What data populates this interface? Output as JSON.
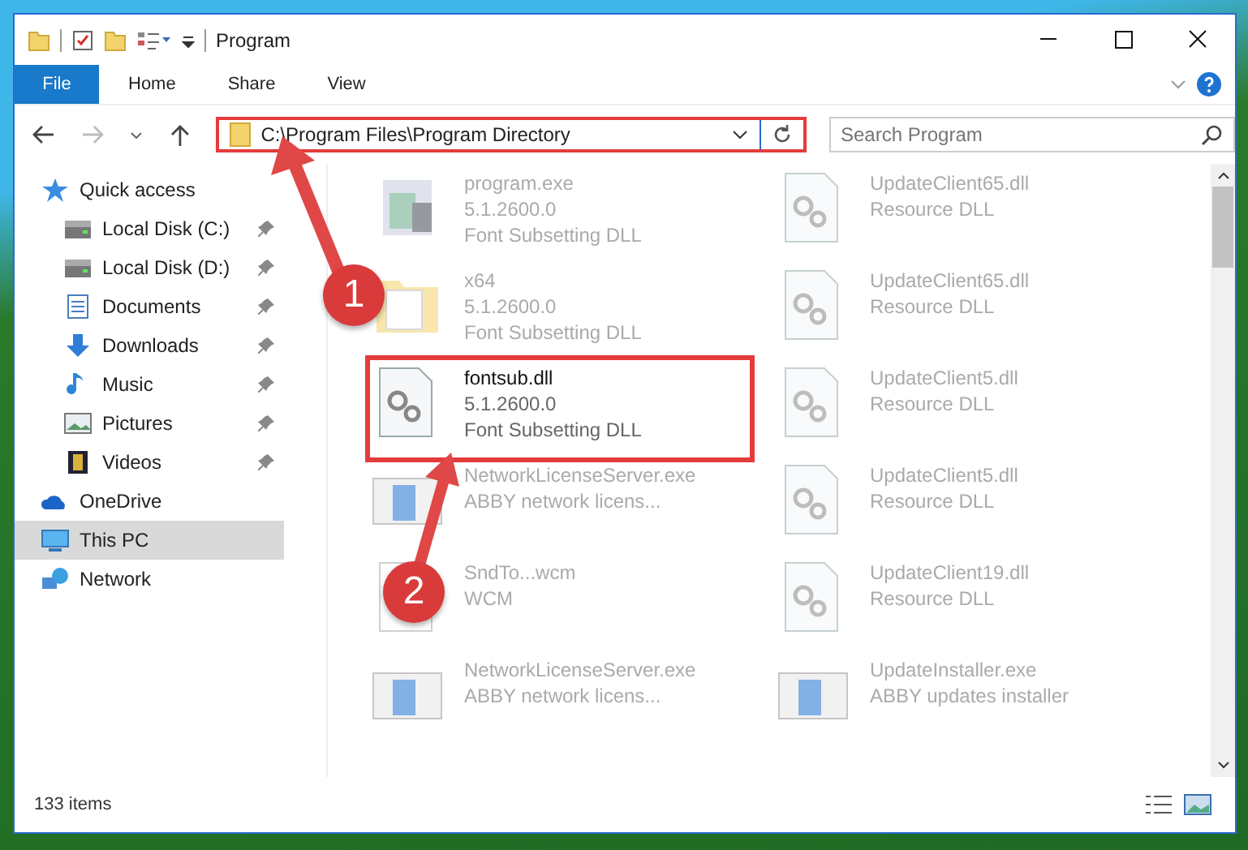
{
  "window": {
    "title": "Program"
  },
  "ribbon_tabs": [
    {
      "label": "File",
      "selected": true
    },
    {
      "label": "Home",
      "selected": false
    },
    {
      "label": "Share",
      "selected": false
    },
    {
      "label": "View",
      "selected": false
    }
  ],
  "address": {
    "path": "C:\\Program Files\\Program Directory"
  },
  "search": {
    "placeholder": "Search Program"
  },
  "sidebar": {
    "items": [
      {
        "label": "Quick access",
        "kind": "star",
        "selected": false,
        "children": [
          {
            "label": "Local Disk (C:)",
            "kind": "disk",
            "pinned": true,
            "selected": false
          },
          {
            "label": "Local Disk (D:)",
            "kind": "disk",
            "pinned": true,
            "selected": false
          },
          {
            "label": "Documents",
            "kind": "document",
            "pinned": true,
            "selected": false
          },
          {
            "label": "Downloads",
            "kind": "download",
            "pinned": true,
            "selected": false
          },
          {
            "label": "Music",
            "kind": "music",
            "pinned": true,
            "selected": false
          },
          {
            "label": "Pictures",
            "kind": "pictures",
            "pinned": true,
            "selected": false
          },
          {
            "label": "Videos",
            "kind": "videos",
            "pinned": true,
            "selected": false
          }
        ]
      },
      {
        "label": "OneDrive",
        "kind": "cloud",
        "selected": false
      },
      {
        "label": "This PC",
        "kind": "pc",
        "selected": true
      },
      {
        "label": "Network",
        "kind": "network",
        "selected": false
      }
    ]
  },
  "files": [
    {
      "name": "program.exe",
      "lines": [
        "5.1.2600.0",
        "Font Subsetting DLL"
      ],
      "kind": "exe",
      "faded": true
    },
    {
      "name": "UpdateClient65.dll",
      "lines": [
        "Resource DLL"
      ],
      "kind": "dll",
      "faded": true
    },
    {
      "name": "x64",
      "lines": [
        "5.1.2600.0",
        "Font Subsetting DLL"
      ],
      "kind": "folder",
      "faded": true
    },
    {
      "name": "UpdateClient65.dll",
      "lines": [
        "Resource DLL"
      ],
      "kind": "dll",
      "faded": true
    },
    {
      "name": "fontsub.dll",
      "lines": [
        "5.1.2600.0",
        "Font Subsetting DLL"
      ],
      "kind": "dll",
      "faded": false
    },
    {
      "name": "UpdateClient5.dll",
      "lines": [
        "Resource DLL"
      ],
      "kind": "dll",
      "faded": true
    },
    {
      "name": "NetworkLicenseServer.exe",
      "lines": [
        "ABBY network licens..."
      ],
      "kind": "app",
      "faded": true
    },
    {
      "name": "UpdateClient5.dll",
      "lines": [
        "Resource DLL"
      ],
      "kind": "dll",
      "faded": true
    },
    {
      "name": "SndTo...wcm",
      "lines": [
        "WCM"
      ],
      "kind": "blank",
      "faded": true
    },
    {
      "name": "UpdateClient19.dll",
      "lines": [
        "Resource DLL"
      ],
      "kind": "dll",
      "faded": true
    },
    {
      "name": "NetworkLicenseServer.exe",
      "lines": [
        "ABBY network licens..."
      ],
      "kind": "app",
      "faded": true
    },
    {
      "name": "UpdateInstaller.exe",
      "lines": [
        "ABBY updates installer"
      ],
      "kind": "app",
      "faded": true
    }
  ],
  "status_bar": {
    "count": "133 items"
  },
  "annotations": [
    {
      "label": "1"
    },
    {
      "label": "2"
    }
  ]
}
